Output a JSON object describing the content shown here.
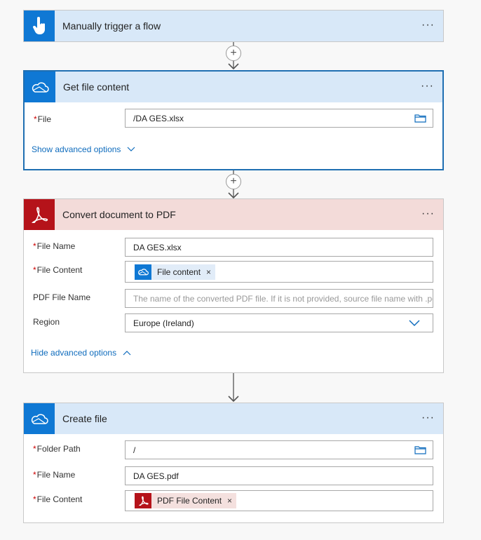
{
  "steps": [
    {
      "title": "Manually trigger a flow",
      "more": "···"
    },
    {
      "title": "Get file content",
      "more": "···",
      "fields": [
        {
          "label": "File",
          "required": "*",
          "value": "/DA GES.xlsx"
        }
      ],
      "toggle_label": "Show advanced options"
    },
    {
      "title": "Convert document to PDF",
      "more": "···",
      "fields": [
        {
          "label": "File Name",
          "required": "*",
          "value": "DA GES.xlsx"
        },
        {
          "label": "File Content",
          "required": "*",
          "token": "File content",
          "token_close": "×"
        },
        {
          "label": "PDF File Name",
          "placeholder": "The name of the converted PDF file. If it is not provided, source file name with .pdf"
        },
        {
          "label": "Region",
          "value": "Europe (Ireland)"
        }
      ],
      "toggle_label": "Hide advanced options"
    },
    {
      "title": "Create file",
      "more": "···",
      "fields": [
        {
          "label": "Folder Path",
          "required": "*",
          "value": "/"
        },
        {
          "label": "File Name",
          "required": "*",
          "value": "DA GES.pdf"
        },
        {
          "label": "File Content",
          "required": "*",
          "token": "PDF File Content",
          "token_close": "×"
        }
      ]
    }
  ],
  "connector_plus": "+",
  "colors": {
    "onedrive_blue": "#0f78d4",
    "adobe_red": "#b5131a",
    "selected_border": "#1f6fb2",
    "link": "#0f6cbd"
  }
}
